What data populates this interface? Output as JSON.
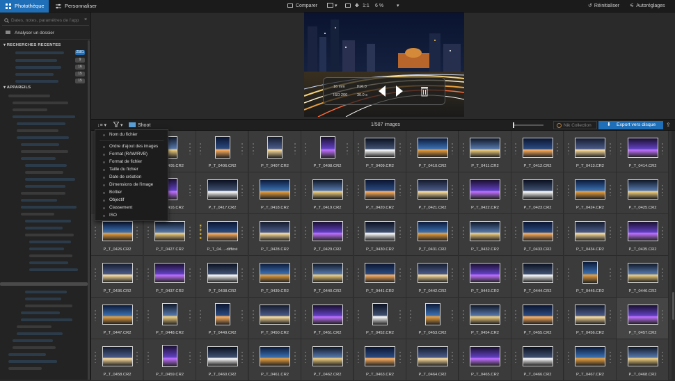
{
  "topbar": {
    "tab_library": "Photothèque",
    "tab_customize": "Personnaliser",
    "compare": "Comparer",
    "ratio": "1:1",
    "zoom": "6 %",
    "reset": "Réinitialiser",
    "autoadjust": "Autoréglages"
  },
  "sidebar": {
    "search_placeholder": "Dates, notes, paramètres de l'app",
    "browse_folder": "Analyser un dossier",
    "recent_title": "RECHERCHES RECENTES",
    "recent_badges": [
      "2581",
      "9",
      "16",
      "15",
      "15"
    ],
    "devices_title": "APPAREILS"
  },
  "preview": {
    "focal": "16 mm",
    "aperture": "f/16.0",
    "iso": "ISO 200",
    "exposure": "30.0 s"
  },
  "toolbar2": {
    "folder": "Shoot",
    "count": "1/587 images",
    "nik": "Nik Collection",
    "export": "Export vers disque"
  },
  "sort_menu": {
    "items": [
      "Nom du fichier",
      "Ordre d'ajout des images",
      "Format (RAW/RVB)",
      "Format de fichier",
      "Taille du fichier",
      "Date de création",
      "Dimensions de l'image",
      "Boîtier",
      "Objectif",
      "Classement",
      "ISO"
    ]
  },
  "thumbnails": [
    [
      "P_T_0405.CR2",
      "P_T_0406.CR2",
      "P_T_0407.CR2",
      "P_T_0408.CR2",
      "P_T_0409.CR2",
      "P_T_0410.CR2",
      "P_T_0411.CR2",
      "P_T_0412.CR2",
      "P_T_0413.CR2",
      "P_T_0414.CR2"
    ],
    [
      "P_T_0416.CR2",
      "P_T_0417.CR2",
      "P_T_0418.CR2",
      "P_T_0419.CR2",
      "P_T_0420.CR2",
      "P_T_0421.CR2",
      "P_T_0422.CR2",
      "P_T_0423.CR2",
      "P_T_0424.CR2",
      "P_T_0425.CR2"
    ],
    [
      "P_T_0426.CR2",
      "P_T_0427.CR2",
      "P_T_04…-différé",
      "P_T_0428.CR2",
      "P_T_0429.CR2",
      "P_T_0430.CR2",
      "P_T_0431.CR2",
      "P_T_0432.CR2",
      "P_T_0433.CR2",
      "P_T_0434.CR2",
      "P_T_0435.CR2"
    ],
    [
      "P_T_0436.CR2",
      "P_T_0437.CR2",
      "P_T_0438.CR2",
      "P_T_0439.CR2",
      "P_T_0440.CR2",
      "P_T_0441.CR2",
      "P_T_0442.CR2",
      "P_T_0443.CR2",
      "P_T_0444.CR2",
      "P_T_0445.CR2",
      "P_T_0446.CR2"
    ],
    [
      "P_T_0447.CR2",
      "P_T_0448.CR2",
      "P_T_0449.CR2",
      "P_T_0450.CR2",
      "P_T_0451.CR2",
      "P_T_0452.CR2",
      "P_T_0453.CR2",
      "P_T_0454.CR2",
      "P_T_0455.CR2",
      "P_T_0456.CR2",
      "P_T_0457.CR2"
    ],
    [
      "P_T_0458.CR2",
      "P_T_0459.CR2",
      "P_T_0460.CR2",
      "P_T_0461.CR2",
      "P_T_0462.CR2",
      "P_T_0463.CR2",
      "P_T_0464.CR2",
      "P_T_0465.CR2",
      "P_T_0466.CR2",
      "P_T_0467.CR2",
      "P_T_0468.CR2"
    ]
  ],
  "colors": {
    "accent": "#1e6fb8",
    "background": "#2b2b2b"
  }
}
